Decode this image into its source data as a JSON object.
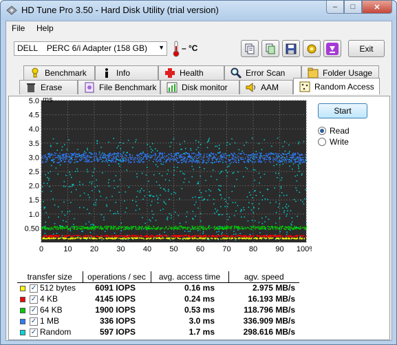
{
  "window": {
    "title": "HD Tune Pro 3.50 - Hard Disk Utility (trial version)",
    "minimize_glyph": "–",
    "maximize_glyph": "□",
    "close_glyph": "✕"
  },
  "menu": [
    "File",
    "Help"
  ],
  "toolbar": {
    "drive": "DELL    PERC 6/i Adapter (158 GB)",
    "temperature": "– °C",
    "exit_label": "Exit",
    "icons": [
      "copy-icon",
      "copy-screen-icon",
      "save-icon",
      "options-icon",
      "download-icon"
    ]
  },
  "tabs_row1": [
    {
      "label": "Benchmark",
      "icon": "benchmark-icon"
    },
    {
      "label": "Info",
      "icon": "info-icon"
    },
    {
      "label": "Health",
      "icon": "health-icon"
    },
    {
      "label": "Error Scan",
      "icon": "error-scan-icon"
    },
    {
      "label": "Folder Usage",
      "icon": "folder-usage-icon"
    }
  ],
  "tabs_row2": [
    {
      "label": "Erase",
      "icon": "erase-icon"
    },
    {
      "label": "File Benchmark",
      "icon": "file-benchmark-icon"
    },
    {
      "label": "Disk monitor",
      "icon": "disk-monitor-icon"
    },
    {
      "label": "AAM",
      "icon": "aam-icon"
    },
    {
      "label": "Random Access",
      "icon": "random-access-icon"
    }
  ],
  "controls": {
    "start_label": "Start",
    "read_label": "Read",
    "write_label": "Write",
    "mode": "Read"
  },
  "chart_data": {
    "type": "scatter",
    "ylabel": "ms",
    "yticks": [
      "5.0",
      "4.5",
      "4.0",
      "3.5",
      "3.0",
      "2.5",
      "2.0",
      "1.5",
      "1.0",
      "0.50"
    ],
    "xticks": [
      "0",
      "10",
      "20",
      "30",
      "40",
      "50",
      "60",
      "70",
      "80",
      "90",
      "100%"
    ],
    "ylim": [
      0,
      5
    ],
    "xlim": [
      0,
      100
    ],
    "grid": true,
    "series": [
      {
        "name": "512 bytes",
        "color": "#ffff00",
        "access_ms": 0.16
      },
      {
        "name": "4 KB",
        "color": "#ff0000",
        "access_ms": 0.24
      },
      {
        "name": "64 KB",
        "color": "#00cc00",
        "access_ms": 0.53
      },
      {
        "name": "1 MB",
        "color": "#2f7bff",
        "access_ms": 3.0
      },
      {
        "name": "Random",
        "color": "#00d8d8",
        "access_ms": 1.7
      }
    ]
  },
  "results": {
    "headers": [
      "transfer size",
      "operations / sec",
      "avg. access time",
      "agv. speed"
    ],
    "rows": [
      {
        "size": "512 bytes",
        "color": "#ffff00",
        "ops": "6091 IOPS",
        "access": "0.16 ms",
        "speed": "2.975 MB/s"
      },
      {
        "size": "4 KB",
        "color": "#ff0000",
        "ops": "4145 IOPS",
        "access": "0.24 ms",
        "speed": "16.193 MB/s"
      },
      {
        "size": "64 KB",
        "color": "#00cc00",
        "ops": "1900 IOPS",
        "access": "0.53 ms",
        "speed": "118.796 MB/s"
      },
      {
        "size": "1 MB",
        "color": "#2f7bff",
        "ops": "336 IOPS",
        "access": "3.0 ms",
        "speed": "336.909 MB/s"
      },
      {
        "size": "Random",
        "color": "#00d8d8",
        "ops": "597 IOPS",
        "access": "1.7 ms",
        "speed": "298.616 MB/s"
      }
    ]
  }
}
